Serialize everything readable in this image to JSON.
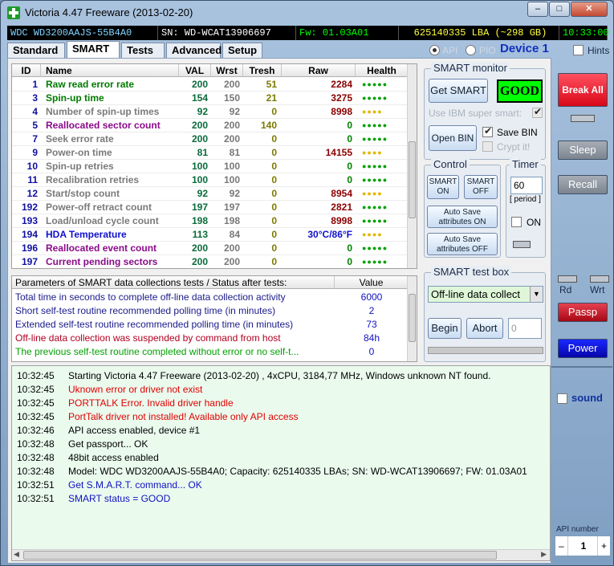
{
  "window": {
    "title": "Victoria 4.47   Freeware (2013-02-20)"
  },
  "info_bar": {
    "model": "WDC WD3200AAJS-55B4A0",
    "serial": "SN: WD-WCAT13906697",
    "firmware": "Fw: 01.03A01",
    "lba": "625140335 LBA (~298 GB)",
    "clock": "10:33:00"
  },
  "tabs": [
    "Standard",
    "SMART",
    "Tests",
    "Advanced",
    "Setup"
  ],
  "access": {
    "api": "API",
    "pio": "PIO",
    "device": "Device 1",
    "hints": "Hints"
  },
  "smart_table": {
    "headers": [
      "ID",
      "Name",
      "VAL",
      "Wrst",
      "Tresh",
      "Raw",
      "Health"
    ],
    "rows": [
      {
        "id": "1",
        "name": "Raw read error rate",
        "val": "200",
        "wrst": "200",
        "tresh": "51",
        "raw": "2284",
        "health": "●●●●●"
      },
      {
        "id": "3",
        "name": "Spin-up time",
        "val": "154",
        "wrst": "150",
        "tresh": "21",
        "raw": "3275",
        "health": "●●●●●"
      },
      {
        "id": "4",
        "name": "Number of spin-up times",
        "val": "92",
        "wrst": "92",
        "tresh": "0",
        "raw": "8998",
        "health": "●●●●"
      },
      {
        "id": "5",
        "name": "Reallocated sector count",
        "val": "200",
        "wrst": "200",
        "tresh": "140",
        "raw": "0",
        "health": "●●●●●"
      },
      {
        "id": "7",
        "name": "Seek error rate",
        "val": "200",
        "wrst": "200",
        "tresh": "0",
        "raw": "0",
        "health": "●●●●●"
      },
      {
        "id": "9",
        "name": "Power-on time",
        "val": "81",
        "wrst": "81",
        "tresh": "0",
        "raw": "14155",
        "health": "●●●●"
      },
      {
        "id": "10",
        "name": "Spin-up retries",
        "val": "100",
        "wrst": "100",
        "tresh": "0",
        "raw": "0",
        "health": "●●●●●"
      },
      {
        "id": "11",
        "name": "Recalibration retries",
        "val": "100",
        "wrst": "100",
        "tresh": "0",
        "raw": "0",
        "health": "●●●●●"
      },
      {
        "id": "12",
        "name": "Start/stop count",
        "val": "92",
        "wrst": "92",
        "tresh": "0",
        "raw": "8954",
        "health": "●●●●"
      },
      {
        "id": "192",
        "name": "Power-off retract count",
        "val": "197",
        "wrst": "197",
        "tresh": "0",
        "raw": "2821",
        "health": "●●●●●"
      },
      {
        "id": "193",
        "name": "Load/unload cycle count",
        "val": "198",
        "wrst": "198",
        "tresh": "0",
        "raw": "8998",
        "health": "●●●●●"
      },
      {
        "id": "194",
        "name": "HDA Temperature",
        "val": "113",
        "wrst": "84",
        "tresh": "0",
        "raw": "30°C/86°F",
        "health": "●●●●"
      },
      {
        "id": "196",
        "name": "Reallocated event count",
        "val": "200",
        "wrst": "200",
        "tresh": "0",
        "raw": "0",
        "health": "●●●●●"
      },
      {
        "id": "197",
        "name": "Current pending sectors",
        "val": "200",
        "wrst": "200",
        "tresh": "0",
        "raw": "0",
        "health": "●●●●●"
      }
    ]
  },
  "smart_monitor": {
    "label": "SMART monitor",
    "get_smart": "Get SMART",
    "status": "GOOD",
    "ibm": "Use IBM super smart:",
    "open_bin": "Open BIN",
    "save_bin": "Save BIN",
    "crypt": "Crypt it!"
  },
  "control": {
    "label": "Control",
    "smart_on": "SMART ON",
    "smart_off": "SMART OFF",
    "autosave_on": "Auto Save attributes ON",
    "autosave_off": "Auto Save attributes OFF"
  },
  "timer": {
    "label": "Timer",
    "value": "60",
    "period": "[ period ]",
    "on": "ON"
  },
  "params": {
    "header": "Parameters of SMART data collections tests / Status after tests:",
    "value_header": "Value",
    "rows": [
      {
        "text": "Total time in seconds to complete off-line data collection activity",
        "value": "6000"
      },
      {
        "text": "Short self-test routine recommended polling time (in minutes)",
        "value": "2"
      },
      {
        "text": "Extended self-test routine recommended polling time (in minutes)",
        "value": "73"
      },
      {
        "text": "Off-line data collection was suspended by command from host",
        "value": "84h"
      },
      {
        "text": "The previous self-test routine completed without error or no self-t...",
        "value": "0"
      }
    ]
  },
  "test_box": {
    "label": "SMART test box",
    "selected": "Off-line data collect",
    "begin": "Begin",
    "abort": "Abort",
    "field": "0"
  },
  "log": [
    {
      "time": "10:32:45",
      "msg": "Starting Victoria 4.47   Freeware (2013-02-20) , 4xCPU, 3184,77 MHz, Windows unknown NT found."
    },
    {
      "time": "10:32:45",
      "msg": "Uknown error or driver not exist"
    },
    {
      "time": "10:32:45",
      "msg": "PORTTALK Error. Invalid driver handle"
    },
    {
      "time": "10:32:45",
      "msg": "PortTalk driver not installed! Available only API access"
    },
    {
      "time": "10:32:46",
      "msg": "API access enabled, device #1"
    },
    {
      "time": "10:32:48",
      "msg": "Get passport... OK"
    },
    {
      "time": "10:32:48",
      "msg": "48bit access enabled"
    },
    {
      "time": "10:32:48",
      "msg": "Model: WDC WD3200AAJS-55B4A0; Capacity: 625140335 LBAs; SN: WD-WCAT13906697; FW: 01.03A01"
    },
    {
      "time": "10:32:51",
      "msg": "Get S.M.A.R.T. command... OK"
    },
    {
      "time": "10:32:51",
      "msg": "SMART status = GOOD"
    }
  ],
  "side": {
    "break_all": "Break All",
    "sleep": "Sleep",
    "recall": "Recall",
    "rd": "Rd",
    "wrt": "Wrt",
    "passp": "Passp",
    "power": "Power",
    "sound": "sound",
    "api_number_label": "API number",
    "api_number": "1",
    "minus": "–",
    "plus": "+"
  },
  "colors": {
    "accent_green": "#00ff00",
    "break_red": "#e0101a",
    "power_blue": "#0a0acc",
    "log_bg": "#eafbee"
  }
}
